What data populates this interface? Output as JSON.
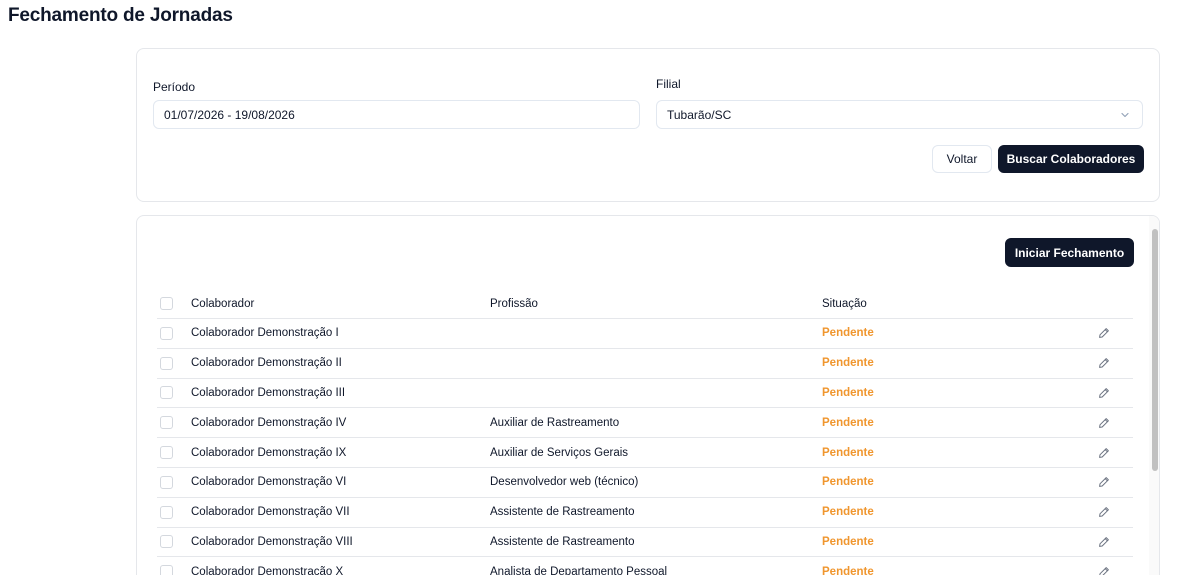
{
  "page": {
    "title": "Fechamento de Jornadas"
  },
  "filters": {
    "periodo_label": "Período",
    "periodo_value": "01/07/2026 - 19/08/2026",
    "filial_label": "Filial",
    "filial_value": "Tubarão/SC",
    "voltar_label": "Voltar",
    "buscar_label": "Buscar Colaboradores"
  },
  "table": {
    "iniciar_label": "Iniciar Fechamento",
    "headers": {
      "colaborador": "Colaborador",
      "profissao": "Profissão",
      "situacao": "Situação"
    },
    "rows": [
      {
        "colaborador": "Colaborador Demonstração I",
        "profissao": "",
        "situacao": "Pendente"
      },
      {
        "colaborador": "Colaborador Demonstração II",
        "profissao": "",
        "situacao": "Pendente"
      },
      {
        "colaborador": "Colaborador Demonstração III",
        "profissao": "",
        "situacao": "Pendente"
      },
      {
        "colaborador": "Colaborador Demonstração IV",
        "profissao": "Auxiliar de Rastreamento",
        "situacao": "Pendente"
      },
      {
        "colaborador": "Colaborador Demonstração IX",
        "profissao": "Auxiliar de Serviços Gerais",
        "situacao": "Pendente"
      },
      {
        "colaborador": "Colaborador Demonstração VI",
        "profissao": "Desenvolvedor web (técnico)",
        "situacao": "Pendente"
      },
      {
        "colaborador": "Colaborador Demonstração VII",
        "profissao": "Assistente de Rastreamento",
        "situacao": "Pendente"
      },
      {
        "colaborador": "Colaborador Demonstração VIII",
        "profissao": "Assistente de Rastreamento",
        "situacao": "Pendente"
      },
      {
        "colaborador": "Colaborador Demonstração X",
        "profissao": "Analista de Departamento Pessoal",
        "situacao": "Pendente"
      }
    ]
  },
  "colors": {
    "accent": "#0f172a",
    "pending": "#f0962e",
    "border": "#e5e7eb"
  },
  "icons": {
    "select_chevron": "chevron-down-icon",
    "row_action": "pencil-icon"
  }
}
